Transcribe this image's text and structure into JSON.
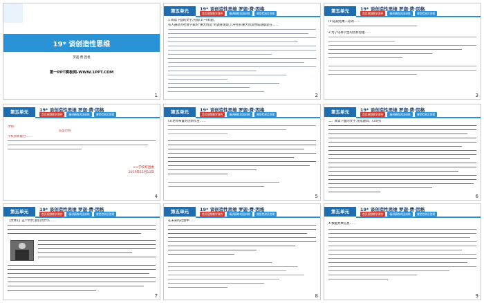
{
  "common": {
    "unit_label": "第五单元",
    "lesson_title": "19* 谈创造性思维 罗迦·费·因格",
    "pills": [
      "首页视频教学课件",
      "精讲精练巩固训练",
      "课堂检测及答案"
    ],
    "nav_label": "→"
  },
  "slides": [
    {
      "num": "1",
      "title": "19* 谈创造性思维",
      "author": "罗迦·费·因格",
      "footer": "第一PPT模板网-WWW.1PPT.COM"
    },
    {
      "num": "2",
      "lines_top": "1.阅读下面的文字,完成(1)~(4)题。",
      "para": "有人通过对社会学家的“重大创造”的调查发现,几乎所有重大创造性成就都是在……"
    },
    {
      "num": "3",
      "line1": "(4)选段结尾一段的……",
      "line2": "2.为了培养学生的创新思维……"
    },
    {
      "num": "4",
      "label_a": "示例:",
      "label_b": "答案示例",
      "note": "学校创新能力……",
      "stamp": "××学校校团委",
      "date": "2019年11月12日"
    },
    {
      "num": "5",
      "intro": "(3)老师布置的创新作业……"
    },
    {
      "num": "6",
      "intro": "二、阅读下面的文字,完成题目。(10分)"
    },
    {
      "num": "7",
      "intro": "【文本1】这个时代,我们为什么……"
    },
    {
      "num": "8",
      "intro": "在未来的社会中……"
    },
    {
      "num": "9",
      "intro": "4.根据文本信息……"
    }
  ]
}
